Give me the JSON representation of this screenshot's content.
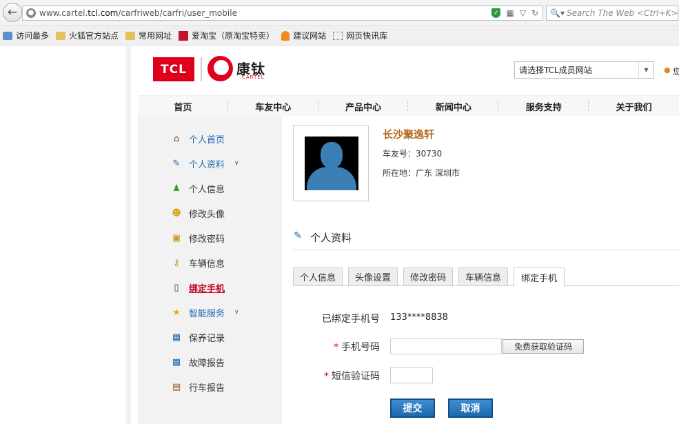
{
  "browser": {
    "url_host_prefix": "www.cartel.",
    "url_host_bold": "tcl.com",
    "url_path": "/carfriweb/carfri/user_mobile",
    "search_placeholder": "Search The Web <Ctrl+K>",
    "bookmarks": [
      {
        "label": "访问最多",
        "icon": "page-icon"
      },
      {
        "label": "火狐官方站点",
        "icon": "folder-icon"
      },
      {
        "label": "常用网址",
        "icon": "folder-icon"
      },
      {
        "label": "爱淘宝（原淘宝特卖）",
        "icon": "taobao-icon"
      },
      {
        "label": "建议网站",
        "icon": "bulb-icon"
      },
      {
        "label": "网页快讯库",
        "icon": "webslice-icon"
      }
    ]
  },
  "header": {
    "logo_tcl": "TCL",
    "logo_brand": "康钛",
    "logo_cartel": "CARTEL",
    "site_select": "请选择TCL成员网站",
    "user_text": "您"
  },
  "nav": [
    "首页",
    "车友中心",
    "产品中心",
    "新闻中心",
    "服务支持",
    "关于我们"
  ],
  "sidebar": [
    {
      "label": "个人首页",
      "icon": "home-icon"
    },
    {
      "label": "个人资料",
      "icon": "edit-icon"
    },
    {
      "label": "个人信息",
      "icon": "user-icon"
    },
    {
      "label": "修改头像",
      "icon": "smiley-icon"
    },
    {
      "label": "修改密码",
      "icon": "lock-icon"
    },
    {
      "label": "车辆信息",
      "icon": "key-icon"
    },
    {
      "label": "绑定手机",
      "icon": "phone-icon"
    },
    {
      "label": "智能服务",
      "icon": "star-icon"
    },
    {
      "label": "保养记录",
      "icon": "book-add-icon"
    },
    {
      "label": "故障报告",
      "icon": "report-icon"
    },
    {
      "label": "行车报告",
      "icon": "clipboard-icon"
    }
  ],
  "profile": {
    "name": "长沙聚逸轩",
    "member_no": "车友号：30730",
    "location": "所在地：广东  深圳市"
  },
  "section_title": "个人资料",
  "tabs": [
    "个人信息",
    "头像设置",
    "修改密码",
    "车辆信息",
    "绑定手机"
  ],
  "form": {
    "bound_label": "已绑定手机号",
    "bound_value": "133****8838",
    "phone_label": "手机号码",
    "get_code": "免费获取验证码",
    "code_label": "短信验证码",
    "required_mark": "*",
    "submit": "提交",
    "cancel": "取消"
  },
  "colors": {
    "brand_red": "#e0001b",
    "link_blue": "#1f67b1",
    "name_brown": "#b5651d",
    "button_blue": "#1f68ad"
  }
}
